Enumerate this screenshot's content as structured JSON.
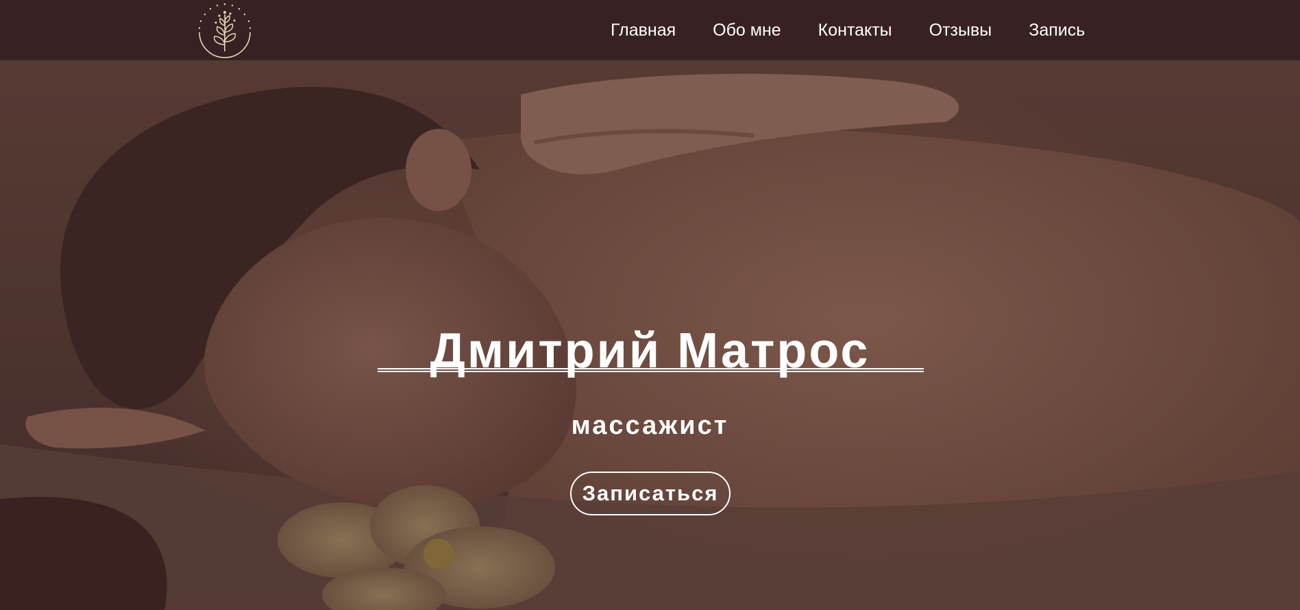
{
  "header": {
    "logo_icon": "leaf-branch-logo",
    "nav": [
      {
        "label": "Главная"
      },
      {
        "label": "Обо мне"
      },
      {
        "label": "Контакты"
      },
      {
        "label": "Отзывы"
      },
      {
        "label": "Запись"
      }
    ]
  },
  "hero": {
    "title": "Дмитрий Матрос",
    "subtitle": "массажист",
    "cta_label": "Записаться"
  },
  "colors": {
    "navbar": "#372123",
    "text": "#ffffff",
    "logo_stroke": "#e8d7b8"
  }
}
